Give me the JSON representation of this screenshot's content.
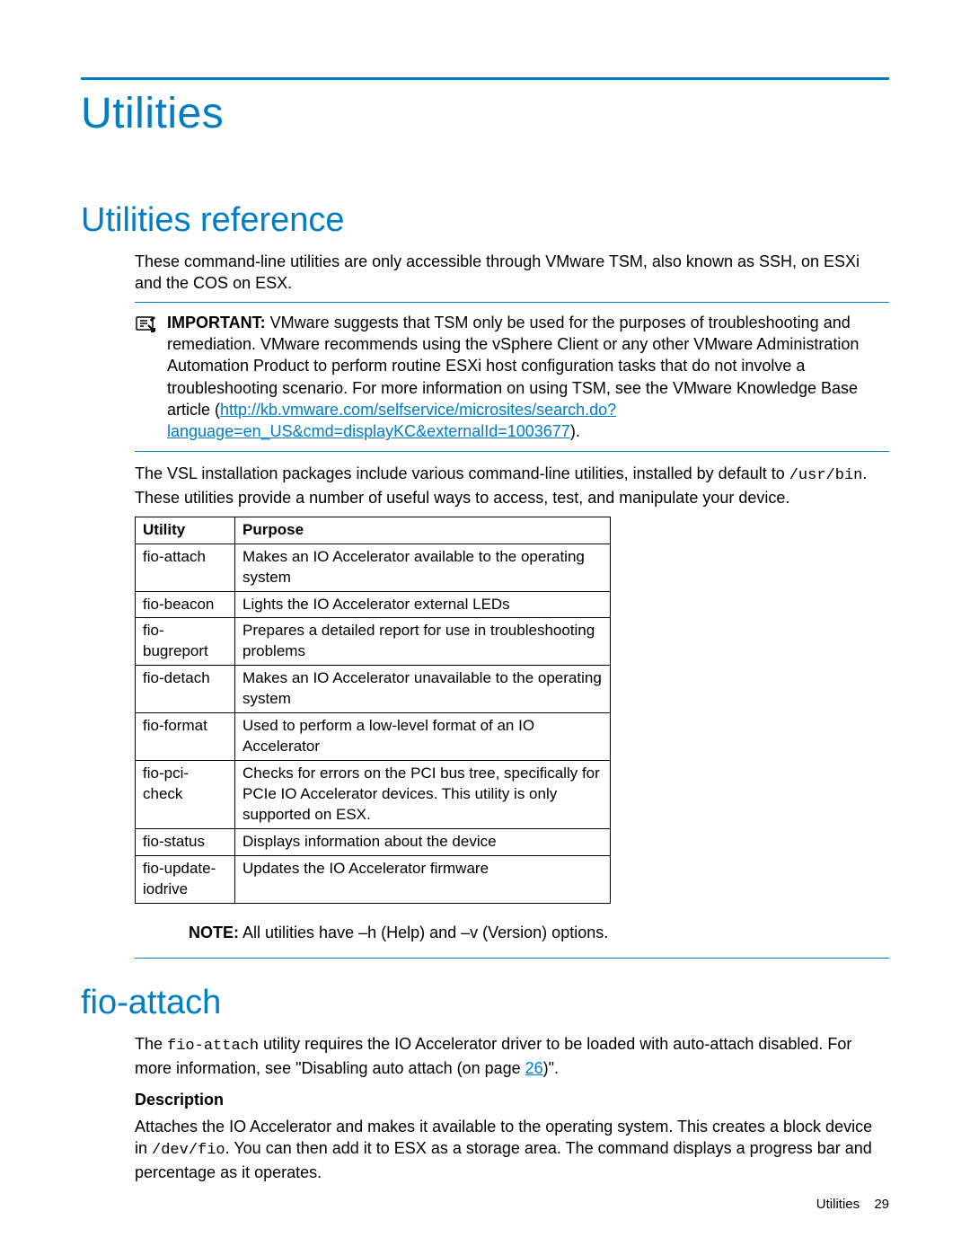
{
  "title": "Utilities",
  "section1": {
    "heading": "Utilities reference",
    "intro": "These command-line utilities are only accessible through VMware TSM, also known as SSH, on ESXi and the COS on ESX.",
    "important_label": "IMPORTANT:",
    "important_body_1": "VMware suggests that TSM only be used for the purposes of troubleshooting and remediation. VMware recommends using the vSphere Client or any other VMware Administration Automation Product to perform routine ESXi host configuration tasks that do not involve a troubleshooting scenario. For more information on using TSM, see the VMware Knowledge Base article (",
    "important_link": "http://kb.vmware.com/selfservice/microsites/search.do?language=en_US&cmd=displayKC&externalId=1003677",
    "important_body_2": ").",
    "post_1a": "The VSL installation packages include various command-line utilities, installed by default to ",
    "post_1_code": "/usr/bin",
    "post_1b": ". These utilities provide a number of useful ways to access, test, and manipulate your device.",
    "table": {
      "headers": [
        "Utility",
        "Purpose"
      ],
      "rows": [
        [
          "fio-attach",
          "Makes an IO Accelerator available to the operating system"
        ],
        [
          "fio-beacon",
          "Lights the IO Accelerator external LEDs"
        ],
        [
          "fio-bugreport",
          "Prepares a detailed report for use in troubleshooting problems"
        ],
        [
          "fio-detach",
          "Makes an IO Accelerator unavailable to the operating system"
        ],
        [
          "fio-format",
          "Used to perform a low-level format of an IO Accelerator"
        ],
        [
          "fio-pci-check",
          "Checks for errors on the PCI bus tree, specifically for PCIe IO Accelerator devices. This utility is only supported on ESX."
        ],
        [
          "fio-status",
          "Displays information about the device"
        ],
        [
          "fio-update-iodrive",
          "Updates the IO Accelerator firmware"
        ]
      ]
    },
    "note_label": "NOTE:",
    "note_body": "All utilities have –h (Help) and –v (Version) options."
  },
  "section2": {
    "heading": "fio-attach",
    "p1a": "The ",
    "p1_code": "fio-attach",
    "p1b": " utility requires the IO Accelerator driver to be loaded with auto-attach disabled. For more information, see \"Disabling auto attach (on page ",
    "p1_link": "26",
    "p1c": ")\".",
    "desc_head": "Description",
    "p2a": "Attaches the IO Accelerator and makes it available to the operating system. This creates a block device in ",
    "p2_code": "/dev/fio",
    "p2b": ". You can then add it to ESX as a storage area. The command displays a progress bar and percentage as it operates."
  },
  "footer": {
    "label": "Utilities",
    "page": "29"
  }
}
